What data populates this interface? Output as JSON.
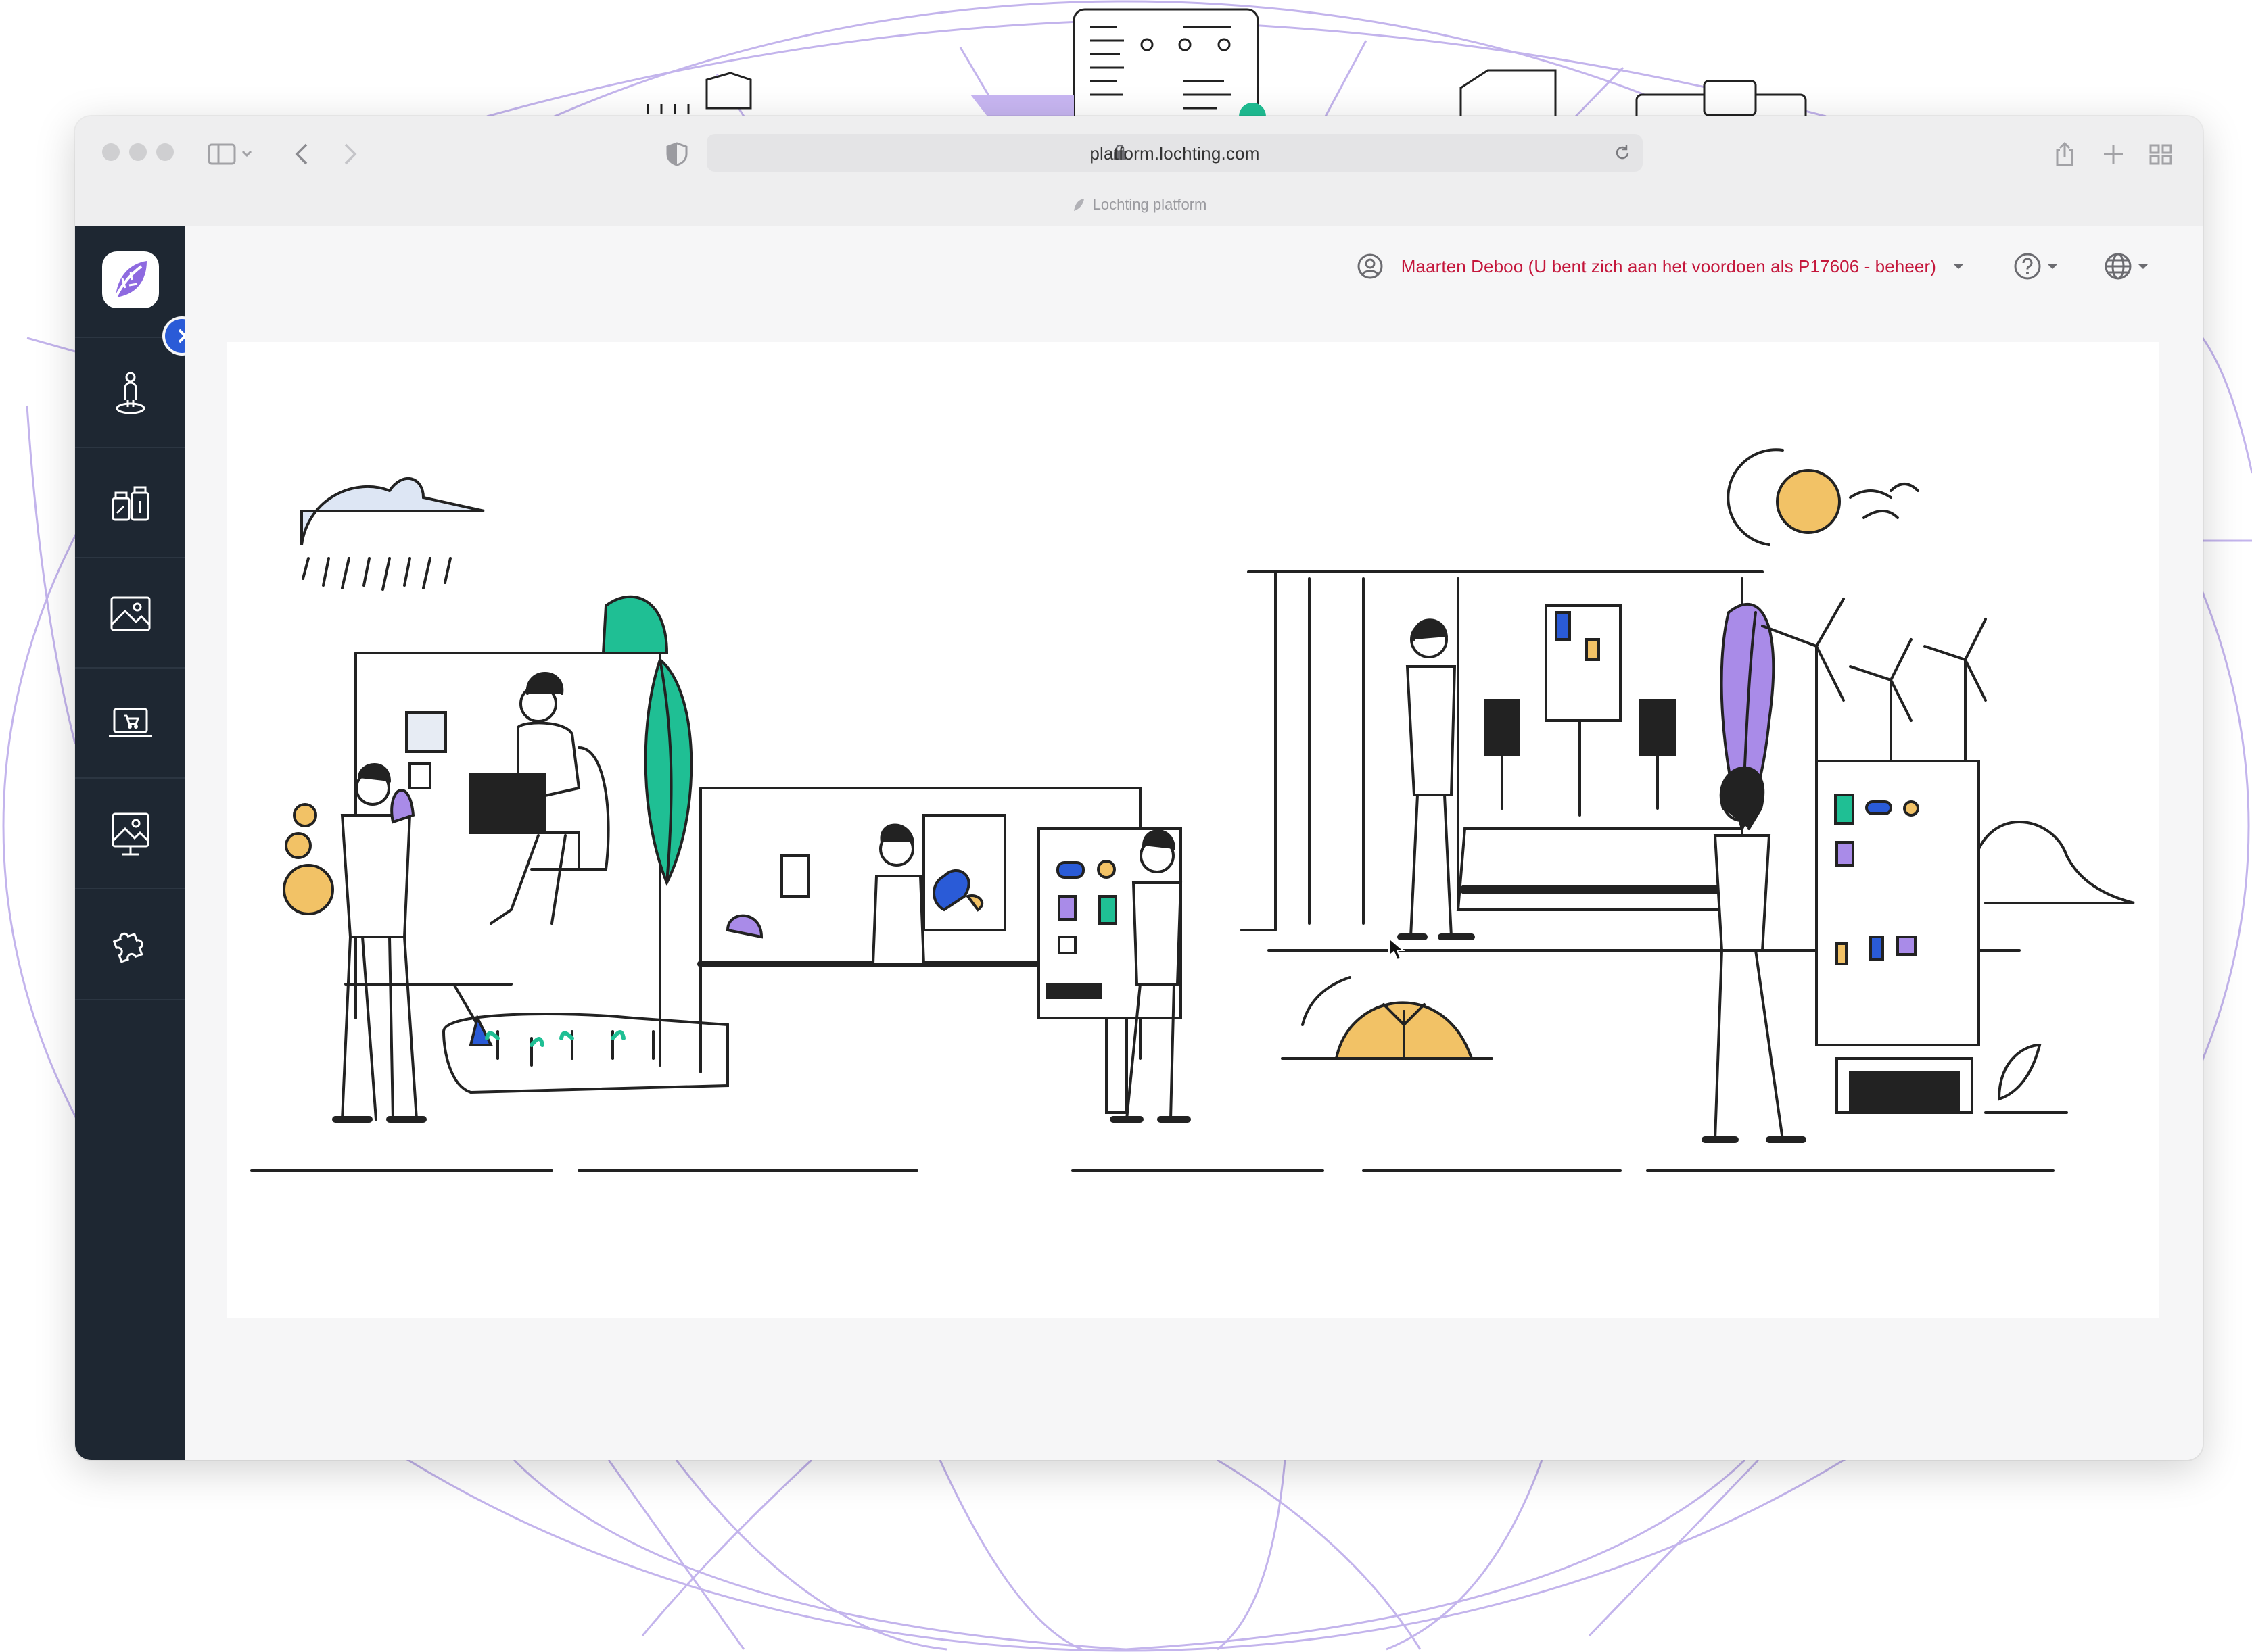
{
  "browser": {
    "url": "platform.lochting.com",
    "tab_title": "Lochting platform"
  },
  "header": {
    "user_name": "Maarten Deboo (U bent zich aan het voordoen als P17606 - beheer)"
  },
  "sidebar": {
    "items": [
      {
        "icon": "person-pin-icon"
      },
      {
        "icon": "products-icon"
      },
      {
        "icon": "image-icon"
      },
      {
        "icon": "webshop-laptop-icon"
      },
      {
        "icon": "digital-signage-icon"
      },
      {
        "icon": "puzzle-icon"
      }
    ]
  },
  "colors": {
    "sidebar_bg": "#1e2732",
    "accent_blue": "#2a5bd7",
    "user_name": "#c4163b",
    "illustration_green": "#1fbf94",
    "illustration_purple": "#a98be8",
    "illustration_yellow": "#f2c266"
  }
}
